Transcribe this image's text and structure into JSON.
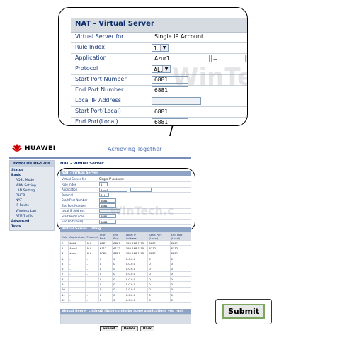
{
  "zoom": {
    "title": "NAT - Virtual Server",
    "rows": [
      {
        "label": "Virtual Server for",
        "value": "Single IP Account"
      },
      {
        "label": "Rule Index",
        "select": "1"
      },
      {
        "label": "Application",
        "input": "Azur1",
        "select": "--"
      },
      {
        "label": "Protocol",
        "select": "ALL"
      },
      {
        "label": "Start Port Number",
        "input": "6881"
      },
      {
        "label": "End Port Number",
        "input": "6881"
      },
      {
        "label": "Local IP Address",
        "input": ""
      },
      {
        "label": "Start Port(Local)",
        "input": "6881"
      },
      {
        "label": "End Port(Local)",
        "input": "6881"
      }
    ],
    "watermark": "WinTech.c"
  },
  "brand": {
    "logo": "HUAWEI",
    "tagline": "Achieving Together",
    "model": "EchoLife HG520s"
  },
  "sidebar": [
    {
      "label": "Status",
      "bold": true
    },
    {
      "label": "Basic",
      "bold": true
    },
    {
      "label": "ADSL Mode"
    },
    {
      "label": "WAN Setting"
    },
    {
      "label": "LAN Setting"
    },
    {
      "label": "DHCP"
    },
    {
      "label": "NAT"
    },
    {
      "label": "IP Route"
    },
    {
      "label": "Wireless Lan"
    },
    {
      "label": "ATM Traffic"
    },
    {
      "label": "Advanced",
      "bold": true
    },
    {
      "label": "Tools",
      "bold": true
    }
  ],
  "crumb": "NAT - Virtual Server",
  "listing_title": "Virtual Server Listing",
  "listing_headers": [
    "Rule",
    "Application",
    "Protocol",
    "Start Port",
    "End Port",
    "Local IP Address",
    "Start Port (Local)",
    "End Port (Local)"
  ],
  "listing_rows": [
    [
      "1",
      "*****",
      "ALL",
      "6881",
      "6881",
      "192.168.1.15",
      "6881",
      "6881"
    ],
    [
      "2",
      "Azur1",
      "ALL",
      "6112",
      "6112",
      "192.168.1.15",
      "6112",
      "6112"
    ],
    [
      "3",
      "ahert",
      "ALL",
      "8080",
      "8881",
      "192.168.1.15",
      "6881",
      "6881"
    ],
    [
      "4",
      "-",
      "-",
      "0",
      "0",
      "0.0.0.0",
      "0",
      "0"
    ],
    [
      "5",
      "-",
      "-",
      "0",
      "0",
      "0.0.0.0",
      "0",
      "0"
    ],
    [
      "6",
      "-",
      "-",
      "0",
      "0",
      "0.0.0.0",
      "0",
      "0"
    ],
    [
      "7",
      "-",
      "-",
      "0",
      "0",
      "0.0.0.0",
      "0",
      "0"
    ],
    [
      "8",
      "-",
      "-",
      "0",
      "0",
      "0.0.0.0",
      "0",
      "0"
    ],
    [
      "9",
      "-",
      "-",
      "0",
      "0",
      "0.0.0.0",
      "0",
      "0"
    ],
    [
      "10",
      "-",
      "-",
      "0",
      "0",
      "0.0.0.0",
      "0",
      "0"
    ],
    [
      "11",
      "-",
      "-",
      "0",
      "0",
      "0.0.0.0",
      "0",
      "0"
    ],
    [
      "12",
      "-",
      "-",
      "0",
      "0",
      "0.0.0.0",
      "0",
      "0"
    ]
  ],
  "listing2_title": "Virtual Server Listing2 (Auto config by some applications you run)",
  "buttons": {
    "submit": "Submit",
    "delete": "Delete",
    "back": "Back"
  },
  "big_submit": "Submit",
  "colors": {
    "header_bg": "#d6dbe2",
    "label_text": "#1a3a7a",
    "highlight_border": "#7aa860"
  }
}
